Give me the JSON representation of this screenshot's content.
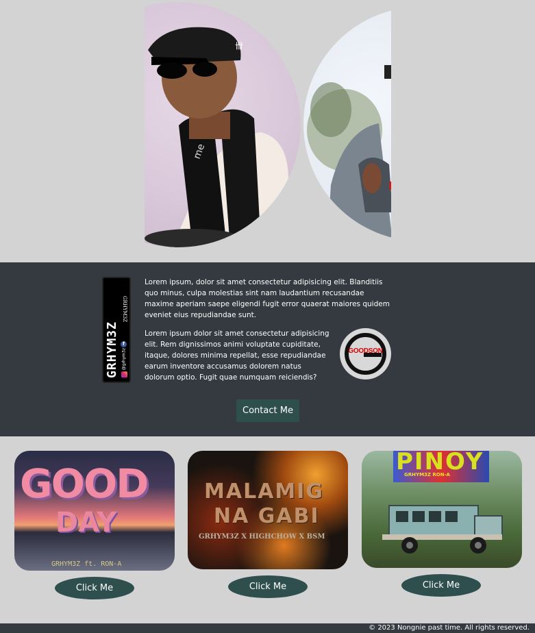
{
  "about": {
    "badge": {
      "brand": "GRHYM3Z",
      "handle": "GRHYM3Z",
      "social": "@grhym3z"
    },
    "paragraph1": "Lorem ipsum, dolor sit amet consectetur adipisicing elit. Blanditiis quo minus, culpa molestias sint nam laudantium recusandae maxime aperiam saepe eligendi fugit error quaerat maiores quidem eveniet eius repudiandae sunt.",
    "paragraph2": "Lorem ipsum dolor sit amet consectetur adipisicing elit. Rem dignissimos animi voluptate cupiditate, itaque, dolores minima repellat, esse repudiandae earum inventore accusamus dolorem natus dolorum optio. Fugit quae numquam reiciendis?",
    "logo_text": "GOODSON",
    "contact_label": "Contact Me"
  },
  "cards": [
    {
      "title_line1": "GOOD",
      "title_line2": "DAY",
      "credit": "GRHYM3Z ft. RON-A",
      "button_label": "Click Me"
    },
    {
      "title_line1": "MALAMIG",
      "title_line2": "NA GABI",
      "credit": "GRHYM3Z X HIGHCHOW X BSM",
      "button_label": "Click Me"
    },
    {
      "title_line1": "PINOY",
      "subtitle": "GRHYM3Z        RON-A",
      "button_label": "Click Me"
    }
  ],
  "footer": {
    "text": "© 2023 Nongnie past time. All rights reserved."
  },
  "colors": {
    "page_bg": "#d3d3d3",
    "section_dark": "#343a40",
    "button": "#2f4f4f"
  }
}
